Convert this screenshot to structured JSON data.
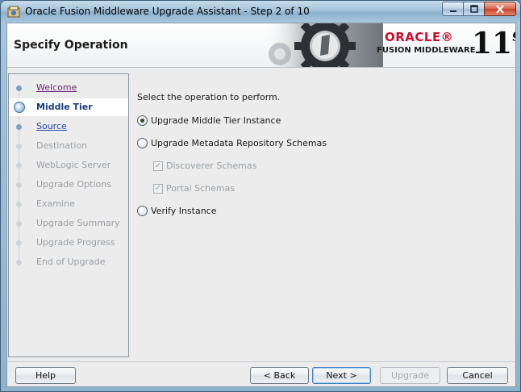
{
  "window": {
    "title": "Oracle Fusion Middleware Upgrade Assistant - Step 2 of 10"
  },
  "banner": {
    "page_title": "Specify Operation",
    "oracle_logo": "ORACLE®",
    "product": "FUSION MIDDLEWARE",
    "version_main": "11",
    "version_sup": "g"
  },
  "nav": {
    "items": [
      {
        "label": "Welcome",
        "state": "done"
      },
      {
        "label": "Middle Tier",
        "state": "active"
      },
      {
        "label": "Source",
        "state": "next"
      },
      {
        "label": "Destination",
        "state": "disabled"
      },
      {
        "label": "WebLogic Server",
        "state": "disabled"
      },
      {
        "label": "Upgrade Options",
        "state": "disabled"
      },
      {
        "label": "Examine",
        "state": "disabled"
      },
      {
        "label": "Upgrade Summary",
        "state": "disabled"
      },
      {
        "label": "Upgrade Progress",
        "state": "disabled"
      },
      {
        "label": "End of Upgrade",
        "state": "disabled"
      }
    ]
  },
  "main": {
    "prompt": "Select the operation to perform.",
    "options": {
      "upgrade_middle_tier": {
        "label": "Upgrade Middle Tier Instance",
        "selected": true
      },
      "upgrade_metadata": {
        "label": "Upgrade Metadata Repository Schemas",
        "selected": false
      },
      "discoverer": {
        "label": "Discoverer Schemas",
        "checked": true,
        "enabled": false
      },
      "portal": {
        "label": "Portal Schemas",
        "checked": true,
        "enabled": false
      },
      "verify_instance": {
        "label": "Verify Instance",
        "selected": false
      }
    }
  },
  "buttons": {
    "help": "Help",
    "back": "< Back",
    "next": "Next >",
    "upgrade": "Upgrade",
    "cancel": "Cancel"
  },
  "colors": {
    "oracle_red": "#c8102e",
    "nav_active_text": "#1b3a7a",
    "nav_link": "#2446a8"
  }
}
